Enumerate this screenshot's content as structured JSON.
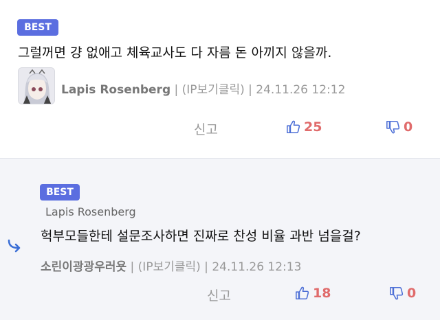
{
  "comment1": {
    "badge": "BEST",
    "text": "그럴꺼면 걍 없애고 체육교사도 다 자름 돈 아끼지 않을까.",
    "author": "Lapis Rosenberg",
    "ip_label": "(IP보기클릭)",
    "date": "24.11.26 12:12",
    "separator": "|",
    "report_label": "신고",
    "likes": "25",
    "dislikes": "0"
  },
  "comment2": {
    "badge": "BEST",
    "reply_to": "Lapis Rosenberg",
    "text": "헉부모들한테 설문조사하면 진짜로 찬성 비율 과반 넘을걸?",
    "author": "소린이광광우러욧",
    "ip_label": "(IP보기클릭)",
    "date": "24.11.26 12:13",
    "separator": "|",
    "report_label": "신고",
    "likes": "18",
    "dislikes": "0"
  },
  "colors": {
    "badge_bg": "#5b6ee0",
    "like": "#e06b6b",
    "thumb_up": "#4d6fd6",
    "reply_bg": "#f4f5f9"
  },
  "icons": [
    "thumbs-up-icon",
    "thumbs-down-icon",
    "reply-arrow-icon",
    "avatar"
  ]
}
